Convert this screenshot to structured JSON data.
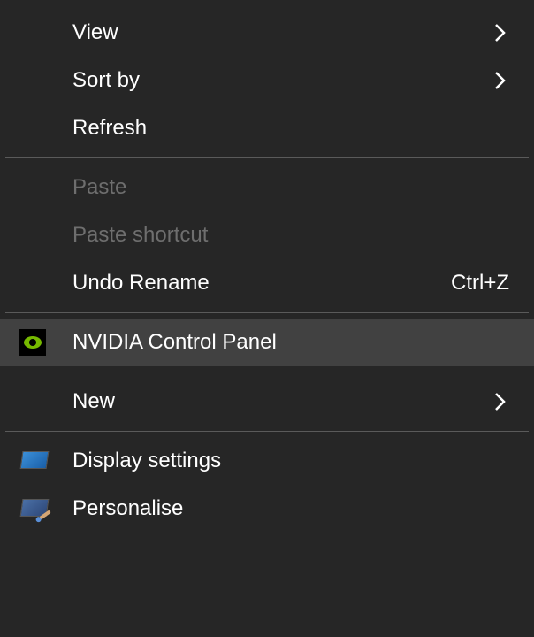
{
  "menu": {
    "items": [
      {
        "label": "View",
        "has_submenu": true,
        "disabled": false
      },
      {
        "label": "Sort by",
        "has_submenu": true,
        "disabled": false
      },
      {
        "label": "Refresh",
        "has_submenu": false,
        "disabled": false
      },
      {
        "label": "Paste",
        "has_submenu": false,
        "disabled": true
      },
      {
        "label": "Paste shortcut",
        "has_submenu": false,
        "disabled": true
      },
      {
        "label": "Undo Rename",
        "has_submenu": false,
        "disabled": false,
        "shortcut": "Ctrl+Z"
      },
      {
        "label": "NVIDIA Control Panel",
        "has_submenu": false,
        "disabled": false,
        "icon": "nvidia",
        "highlighted": true
      },
      {
        "label": "New",
        "has_submenu": true,
        "disabled": false
      },
      {
        "label": "Display settings",
        "has_submenu": false,
        "disabled": false,
        "icon": "display"
      },
      {
        "label": "Personalise",
        "has_submenu": false,
        "disabled": false,
        "icon": "personalise"
      }
    ]
  }
}
